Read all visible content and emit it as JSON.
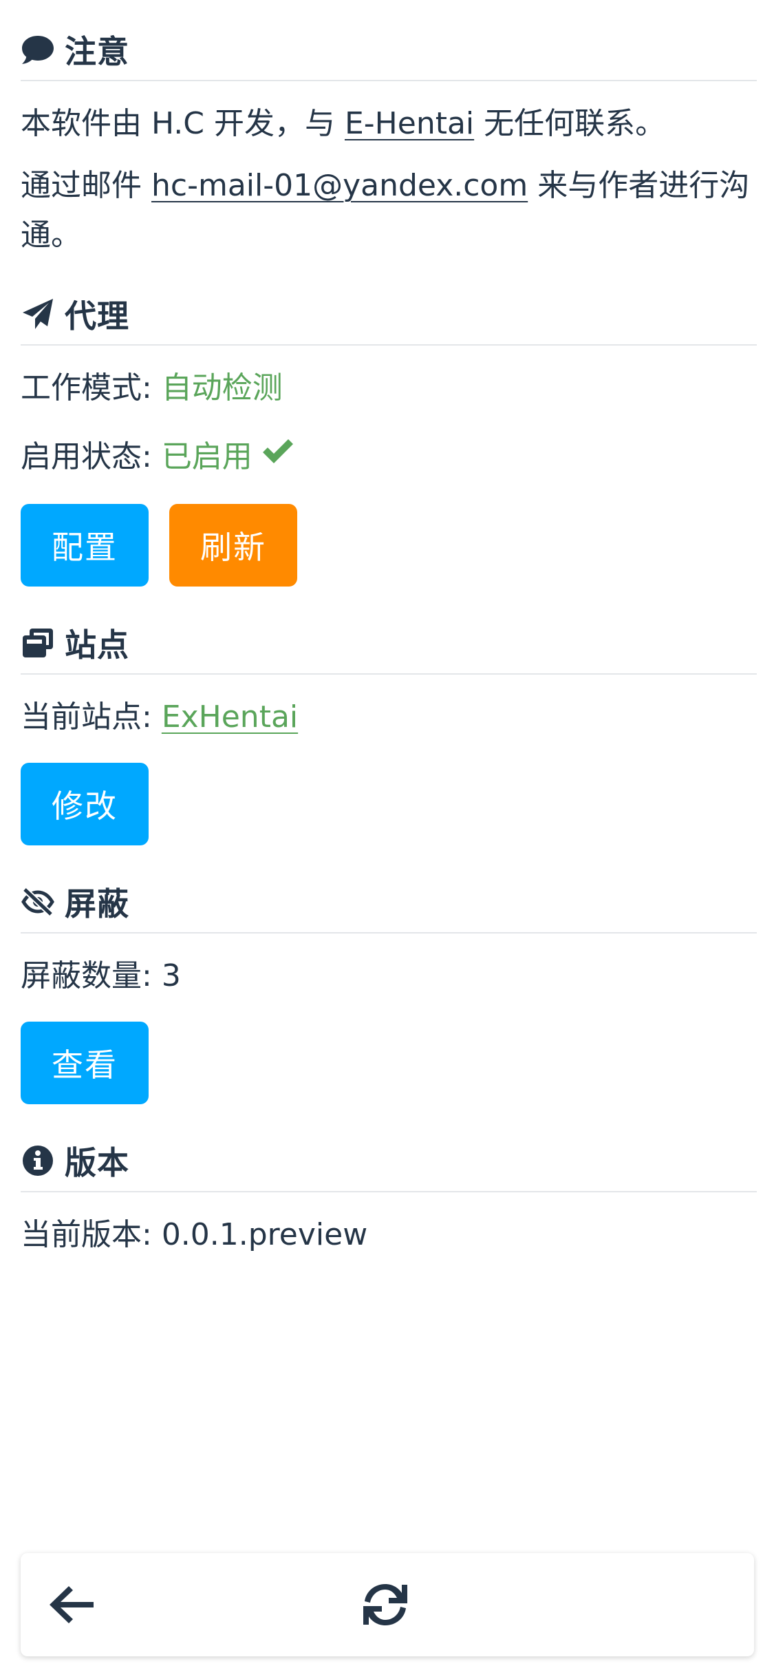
{
  "notice": {
    "title": "注意",
    "icon": "comment-icon",
    "text1_before": "本软件由 H.C 开发，与 ",
    "text1_link": "E-Hentai",
    "text1_after": " 无任何联系。",
    "text2_before": "通过邮件 ",
    "text2_link": "hc-mail-01@yandex.com",
    "text2_after": " 来与作者进行沟通。"
  },
  "proxy": {
    "title": "代理",
    "icon": "paper-plane-icon",
    "mode_label": "工作模式: ",
    "mode_value": "自动检测",
    "status_label": "启用状态: ",
    "status_value": "已启用",
    "config_button": "配置",
    "refresh_button": "刷新"
  },
  "site": {
    "title": "站点",
    "icon": "window-restore-icon",
    "current_label": "当前站点: ",
    "current_value": "ExHentai",
    "modify_button": "修改"
  },
  "block": {
    "title": "屏蔽",
    "icon": "eye-slash-icon",
    "count_label": "屏蔽数量: ",
    "count_value": "3",
    "view_button": "查看"
  },
  "version": {
    "title": "版本",
    "icon": "info-circle-icon",
    "current_label": "当前版本: ",
    "current_value": "0.0.1.preview"
  },
  "bottom_bar": {
    "back_icon": "arrow-left-icon",
    "refresh_icon": "sync-icon"
  },
  "colors": {
    "primary": "#00a8ff",
    "warning": "#ff8a00",
    "success": "#5aa55a",
    "text": "#253547"
  }
}
